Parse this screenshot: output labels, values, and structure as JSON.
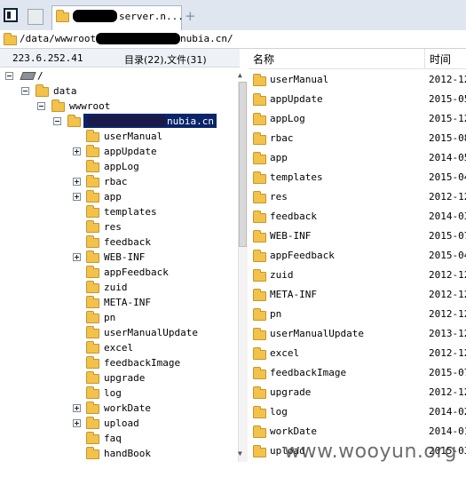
{
  "tab": {
    "title": "server.n..."
  },
  "path": "/data/wwwroot/",
  "path_suffix": "nubia.cn/",
  "info": {
    "ip": "223.6.252.41",
    "counts": "目录(22),文件(31)"
  },
  "tree": {
    "root": "/",
    "data": "data",
    "wwwroot": "wwwroot",
    "site_suffix": "nubia.cn",
    "children": [
      {
        "label": "userManual",
        "expandable": false
      },
      {
        "label": "appUpdate",
        "expandable": true
      },
      {
        "label": "appLog",
        "expandable": false
      },
      {
        "label": "rbac",
        "expandable": true
      },
      {
        "label": "app",
        "expandable": true
      },
      {
        "label": "templates",
        "expandable": false
      },
      {
        "label": "res",
        "expandable": false
      },
      {
        "label": "feedback",
        "expandable": false
      },
      {
        "label": "WEB-INF",
        "expandable": true
      },
      {
        "label": "appFeedback",
        "expandable": false
      },
      {
        "label": "zuid",
        "expandable": false
      },
      {
        "label": "META-INF",
        "expandable": false
      },
      {
        "label": "pn",
        "expandable": false
      },
      {
        "label": "userManualUpdate",
        "expandable": false
      },
      {
        "label": "excel",
        "expandable": false
      },
      {
        "label": "feedbackImage",
        "expandable": false
      },
      {
        "label": "upgrade",
        "expandable": false
      },
      {
        "label": "log",
        "expandable": false
      },
      {
        "label": "workDate",
        "expandable": true
      },
      {
        "label": "upload",
        "expandable": true
      },
      {
        "label": "faq",
        "expandable": false
      },
      {
        "label": "handBook",
        "expandable": false
      }
    ]
  },
  "list": {
    "col_name": "名称",
    "col_time": "时间",
    "rows": [
      {
        "name": "userManual",
        "time": "2012-12"
      },
      {
        "name": "appUpdate",
        "time": "2015-05"
      },
      {
        "name": "appLog",
        "time": "2015-12"
      },
      {
        "name": "rbac",
        "time": "2015-08"
      },
      {
        "name": "app",
        "time": "2014-05"
      },
      {
        "name": "templates",
        "time": "2015-04"
      },
      {
        "name": "res",
        "time": "2012-12"
      },
      {
        "name": "feedback",
        "time": "2014-03"
      },
      {
        "name": "WEB-INF",
        "time": "2015-07"
      },
      {
        "name": "appFeedback",
        "time": "2015-04"
      },
      {
        "name": "zuid",
        "time": "2012-12"
      },
      {
        "name": "META-INF",
        "time": "2012-12"
      },
      {
        "name": "pn",
        "time": "2012-12"
      },
      {
        "name": "userManualUpdate",
        "time": "2013-12"
      },
      {
        "name": "excel",
        "time": "2012-12"
      },
      {
        "name": "feedbackImage",
        "time": "2015-07"
      },
      {
        "name": "upgrade",
        "time": "2012-12"
      },
      {
        "name": "log",
        "time": "2014-02"
      },
      {
        "name": "workDate",
        "time": "2014-01"
      },
      {
        "name": "upload",
        "time": "2015-03"
      }
    ]
  },
  "watermark": "www.wooyun.org"
}
